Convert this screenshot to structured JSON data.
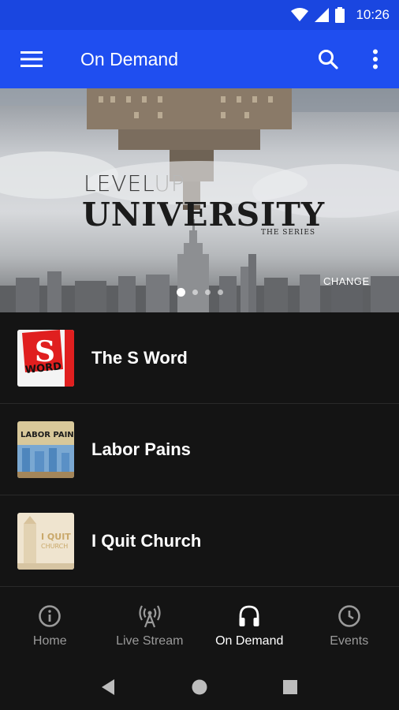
{
  "status_bar": {
    "time": "10:26",
    "icons": [
      "wifi-icon",
      "signal-icon",
      "battery-icon"
    ]
  },
  "app_bar": {
    "title": "On Demand",
    "menu_icon": "menu-icon",
    "search_icon": "search-icon",
    "more_icon": "more-vert-icon"
  },
  "hero": {
    "title_top_a": "LEVEL",
    "title_top_b": "UP",
    "title_main": "UNIVERSITY",
    "title_sub": "THE SERIES",
    "brand": "CHANGE",
    "slide_count": 4,
    "active_slide": 1
  },
  "items": [
    {
      "title": "The S Word",
      "thumb_text_a": "S",
      "thumb_text_b": "WORD",
      "colors": {
        "bg": "#f5f5f5",
        "accent": "#e02020"
      }
    },
    {
      "title": "Labor Pains",
      "thumb_text_a": "LABOR PAINS",
      "colors": {
        "bg": "#d9c89a",
        "accent": "#6fa2d0"
      }
    },
    {
      "title": "I Quit Church",
      "thumb_text_a": "I QUIT",
      "thumb_text_b": "CHURCH",
      "colors": {
        "bg": "#efe4cf",
        "accent": "#c9a86a"
      }
    }
  ],
  "bottom_nav": [
    {
      "label": "Home",
      "icon": "info-circle-icon",
      "active": false
    },
    {
      "label": "Live Stream",
      "icon": "antenna-icon",
      "active": false
    },
    {
      "label": "On Demand",
      "icon": "headphones-icon",
      "active": true
    },
    {
      "label": "Events",
      "icon": "clock-icon",
      "active": false
    }
  ],
  "system_nav": [
    "back-icon",
    "home-icon",
    "recents-icon"
  ],
  "colors": {
    "primary": "#1f4ef0",
    "status_bar": "#1a46e0",
    "background": "#141414",
    "inactive": "#9a9a9a"
  }
}
